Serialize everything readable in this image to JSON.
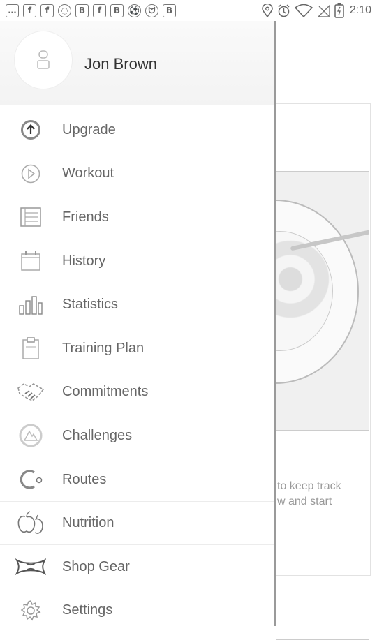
{
  "status_bar": {
    "time": "2:10",
    "left_icons": [
      "chat-icon",
      "facebook-icon",
      "facebook-icon",
      "messenger-icon",
      "b-app-icon",
      "facebook-icon",
      "b-app-icon",
      "soccer-icon",
      "cat-icon",
      "b-app-icon"
    ],
    "left_glyphs": [
      "…",
      "f",
      "f",
      "◌",
      "B",
      "f",
      "B",
      "⚽",
      "ᗢ",
      "B"
    ],
    "right_icons": [
      "location-icon",
      "alarm-icon",
      "wifi-icon",
      "no-signal-icon",
      "battery-icon"
    ]
  },
  "drawer": {
    "user_name": "Jon Brown",
    "items": [
      {
        "label": "Upgrade",
        "icon": "upgrade-arrow-icon"
      },
      {
        "label": "Workout",
        "icon": "play-circle-icon"
      },
      {
        "label": "Friends",
        "icon": "friends-book-icon"
      },
      {
        "label": "History",
        "icon": "calendar-icon"
      },
      {
        "label": "Statistics",
        "icon": "bar-chart-icon"
      },
      {
        "label": "Training Plan",
        "icon": "clipboard-icon"
      },
      {
        "label": "Commitments",
        "icon": "handshake-icon"
      },
      {
        "label": "Challenges",
        "icon": "mountain-badge-icon"
      },
      {
        "label": "Routes",
        "icon": "route-icon"
      },
      {
        "label": "Nutrition",
        "icon": "apple-icon"
      },
      {
        "label": "Shop Gear",
        "icon": "under-armour-logo-icon"
      },
      {
        "label": "Settings",
        "icon": "gear-icon"
      }
    ],
    "active_item": "Nutrition"
  },
  "background": {
    "text_lines": [
      "to keep track",
      "w and start"
    ]
  }
}
